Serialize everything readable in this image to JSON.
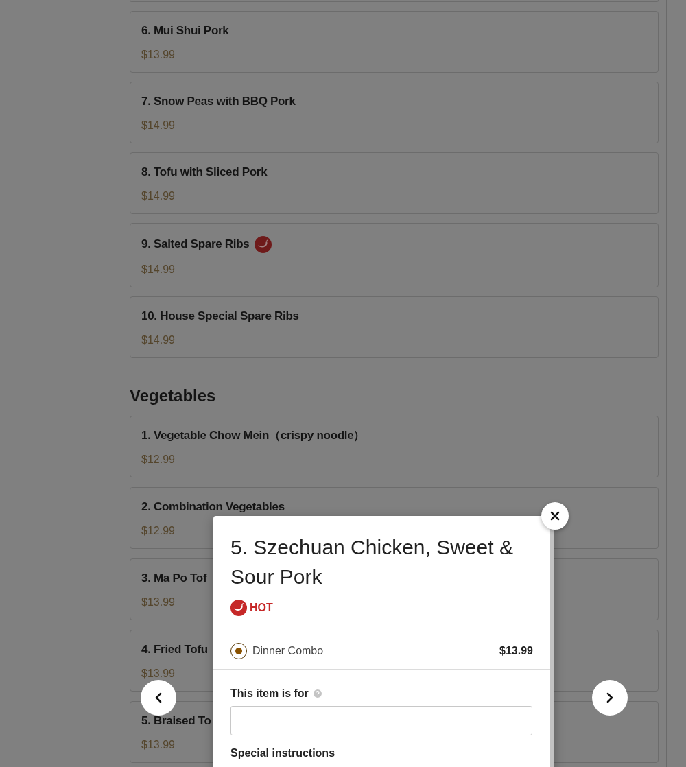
{
  "menu_sections": [
    {
      "items": [
        {
          "name": "6. Mui Shui Pork",
          "price": "$13.99",
          "hot": false
        },
        {
          "name": "7. Snow Peas with BBQ Pork",
          "price": "$14.99",
          "hot": false
        },
        {
          "name": "8. Tofu with Sliced Pork",
          "price": "$14.99",
          "hot": false
        },
        {
          "name": "9. Salted Spare Ribs",
          "price": "$14.99",
          "hot": true
        },
        {
          "name": "10. House Special Spare Ribs",
          "price": "$14.99",
          "hot": false
        }
      ]
    },
    {
      "title": "Vegetables",
      "items": [
        {
          "name": "1. Vegetable Chow Mein（crispy noodle）",
          "price": "$12.99",
          "hot": false
        },
        {
          "name": "2. Combination Vegetables",
          "price": "$12.99",
          "hot": false
        },
        {
          "name": "3. Ma Po Tof",
          "price": "$13.99",
          "hot": false
        },
        {
          "name": "4. Fried Tofu",
          "price": "$13.99",
          "hot": false
        },
        {
          "name": "5. Braised To",
          "price": "$13.99",
          "hot": false
        }
      ]
    }
  ],
  "item_dialog": {
    "title": "5. Szechuan Chicken, Sweet & Sour Pork",
    "tags": [
      {
        "label": "HOT",
        "kind": "spicy"
      }
    ],
    "options": [
      {
        "label": "Dinner Combo",
        "price": "$13.99",
        "selected": true
      }
    ],
    "recipient_field": {
      "label": "This item is for",
      "help": true
    },
    "instructions": {
      "label": "Special instructions"
    }
  }
}
